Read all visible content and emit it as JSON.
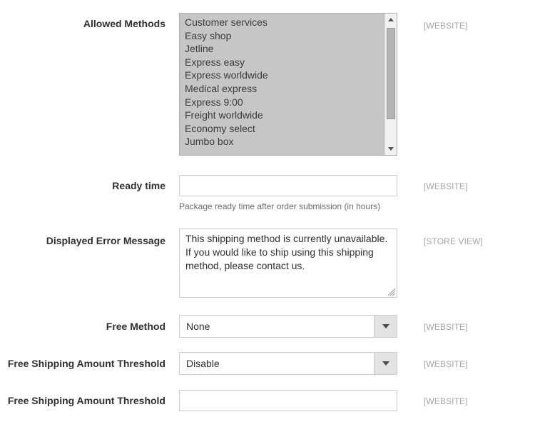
{
  "form": {
    "fields": [
      {
        "id": "allowed-methods",
        "label": "Allowed Methods",
        "type": "multiselect",
        "scope": "[WEBSITE]",
        "options": [
          "Customer services",
          "Easy shop",
          "Jetline",
          "Express easy",
          "Express worldwide",
          "Medical express",
          "Express 9:00",
          "Freight worldwide",
          "Economy select",
          "Jumbo box"
        ]
      },
      {
        "id": "ready-time",
        "label": "Ready time",
        "type": "text",
        "value": "",
        "scope": "[WEBSITE]",
        "note": "Package ready time after order submission (in hours)"
      },
      {
        "id": "displayed-error-message",
        "label": "Displayed Error Message",
        "type": "textarea",
        "value": "This shipping method is currently unavailable. If you would like to ship using this shipping method, please contact us.",
        "scope": "[STORE VIEW]"
      },
      {
        "id": "free-method",
        "label": "Free Method",
        "type": "select",
        "value": "None",
        "scope": "[WEBSITE]"
      },
      {
        "id": "free-shipping-amount-threshold-enable",
        "label": "Free Shipping Amount Threshold",
        "type": "select",
        "value": "Disable",
        "scope": "[WEBSITE]"
      },
      {
        "id": "free-shipping-amount-threshold-value",
        "label": "Free Shipping Amount Threshold",
        "type": "text",
        "value": "",
        "scope": "[WEBSITE]"
      }
    ]
  },
  "icons": {
    "scroll_up": "scroll-up-arrow-icon",
    "scroll_down": "scroll-down-arrow-icon",
    "dropdown": "chevron-down-icon",
    "resize": "resize-grip-icon"
  },
  "colors": {
    "label_text": "#303030",
    "scope_text": "#a6a6a6",
    "note_text": "#6a6a6a",
    "input_border": "#cccccc",
    "listbox_selected_bg": "#c6c6c6",
    "select_button_bg": "#e3e3e3"
  }
}
